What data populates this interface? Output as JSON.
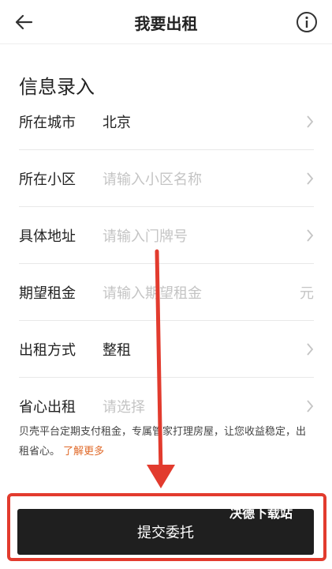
{
  "nav": {
    "back_icon": "arrow-left-icon",
    "title": "我要出租",
    "info_icon": "info-circle-icon"
  },
  "section_title": "信息录入",
  "rows": [
    {
      "label": "所在城市",
      "value": "北京",
      "placeholder": "",
      "trail": "chevron-right-icon"
    },
    {
      "label": "所在小区",
      "value": "",
      "placeholder": "请输入小区名称",
      "trail": "chevron-right-icon"
    },
    {
      "label": "具体地址",
      "value": "",
      "placeholder": "请输入门牌号",
      "trail": "chevron-right-icon"
    },
    {
      "label": "期望租金",
      "value": "",
      "placeholder": "请输入期望租金",
      "trail_text": "元"
    },
    {
      "label": "出租方式",
      "value": "整租",
      "placeholder": "",
      "trail": "chevron-right-icon"
    },
    {
      "label": "省心出租",
      "value": "",
      "placeholder": "请选择",
      "trail": "chevron-right-icon"
    }
  ],
  "description": {
    "text": "贝壳平台定期支付租金，专属管家打理房屋，让您收益稳定，出租省心。",
    "link": "了解更多"
  },
  "submit_label": "提交委托",
  "watermark": "决德下载站",
  "colors": {
    "link": "#e06a2a",
    "button": "#1f1f1f",
    "annotation": "#e23b2e",
    "placeholder": "#c4c4c4"
  }
}
